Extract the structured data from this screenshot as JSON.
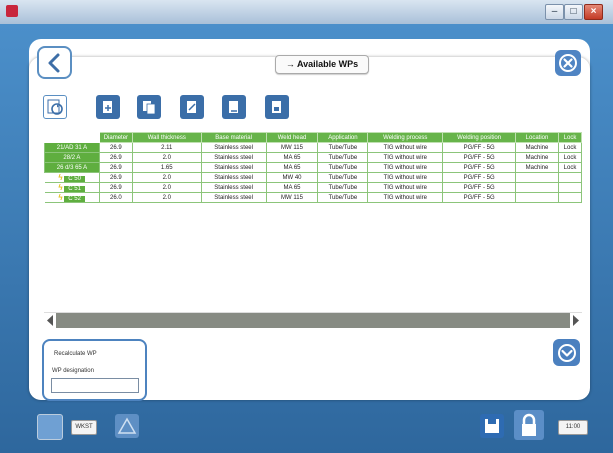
{
  "window": {
    "buttons": [
      "minimize",
      "maximize",
      "close"
    ]
  },
  "header": {
    "title": "→ Available WPs"
  },
  "grid": {
    "columns": [
      "",
      "Diameter",
      "Wall thickness",
      "Base material",
      "Weld head",
      "Application",
      "Welding process",
      "Welding position",
      "Location",
      "Lock"
    ],
    "rows": [
      {
        "id": "21/AD 31 A",
        "cells": [
          "26.9",
          "2.11",
          "Stainless steel",
          "MW 115",
          "Tube/Tube",
          "TIG without wire",
          "PG/FF - 5G",
          "Machine",
          "Lock"
        ]
      },
      {
        "id": "28/2 A",
        "cells": [
          "26.9",
          "2.0",
          "Stainless steel",
          "MA 65",
          "Tube/Tube",
          "TIG without wire",
          "PG/FF - 5G",
          "Machine",
          "Lock"
        ]
      },
      {
        "id": "26 d/3 65 A",
        "cells": [
          "26.9",
          "1.65",
          "Stainless steel",
          "MA 65",
          "Tube/Tube",
          "TIG without wire",
          "PG/FF - 5G",
          "Machine",
          "Lock"
        ]
      },
      {
        "id": "C 50",
        "cells": [
          "26.9",
          "2.0",
          "Stainless steel",
          "MW 40",
          "Tube/Tube",
          "TIG without wire",
          "PG/FF - 5G",
          "",
          ""
        ]
      },
      {
        "id": "C 51",
        "cells": [
          "26.9",
          "2.0",
          "Stainless steel",
          "MA 65",
          "Tube/Tube",
          "TIG without wire",
          "PG/FF - 5G",
          "",
          ""
        ]
      },
      {
        "id": "C 52",
        "cells": [
          "26.0",
          "2.0",
          "Stainless steel",
          "MW 115",
          "Tube/Tube",
          "TIG without wire",
          "PG/FF - 5G",
          "",
          ""
        ]
      }
    ]
  },
  "form": {
    "label1": "Recalculate WP",
    "label2": "WP designation",
    "input_value": ""
  },
  "bottom": {
    "tag1": "WKST",
    "tag2": "11:00"
  }
}
